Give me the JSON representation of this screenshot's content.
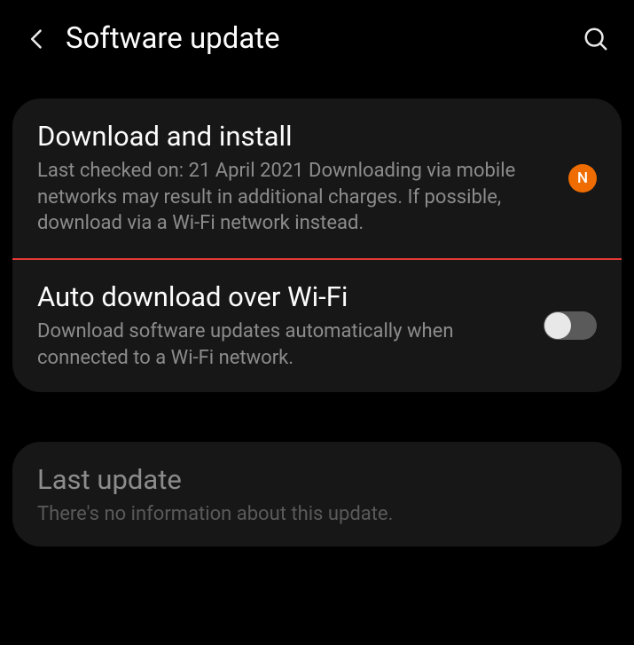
{
  "header": {
    "title": "Software update"
  },
  "items": {
    "download": {
      "title": "Download and install",
      "desc": "Last checked on: 21 April 2021\nDownloading via mobile networks may result in additional charges. If possible, download via a Wi-Fi network instead.",
      "badge": "N"
    },
    "auto": {
      "title": "Auto download over Wi-Fi",
      "desc": "Download software updates automatically when connected to a Wi-Fi network.",
      "toggle": false
    },
    "last": {
      "title": "Last update",
      "desc": "There's no information about this update."
    }
  },
  "colors": {
    "badge": "#ef6c00",
    "highlight": "#e53935"
  }
}
